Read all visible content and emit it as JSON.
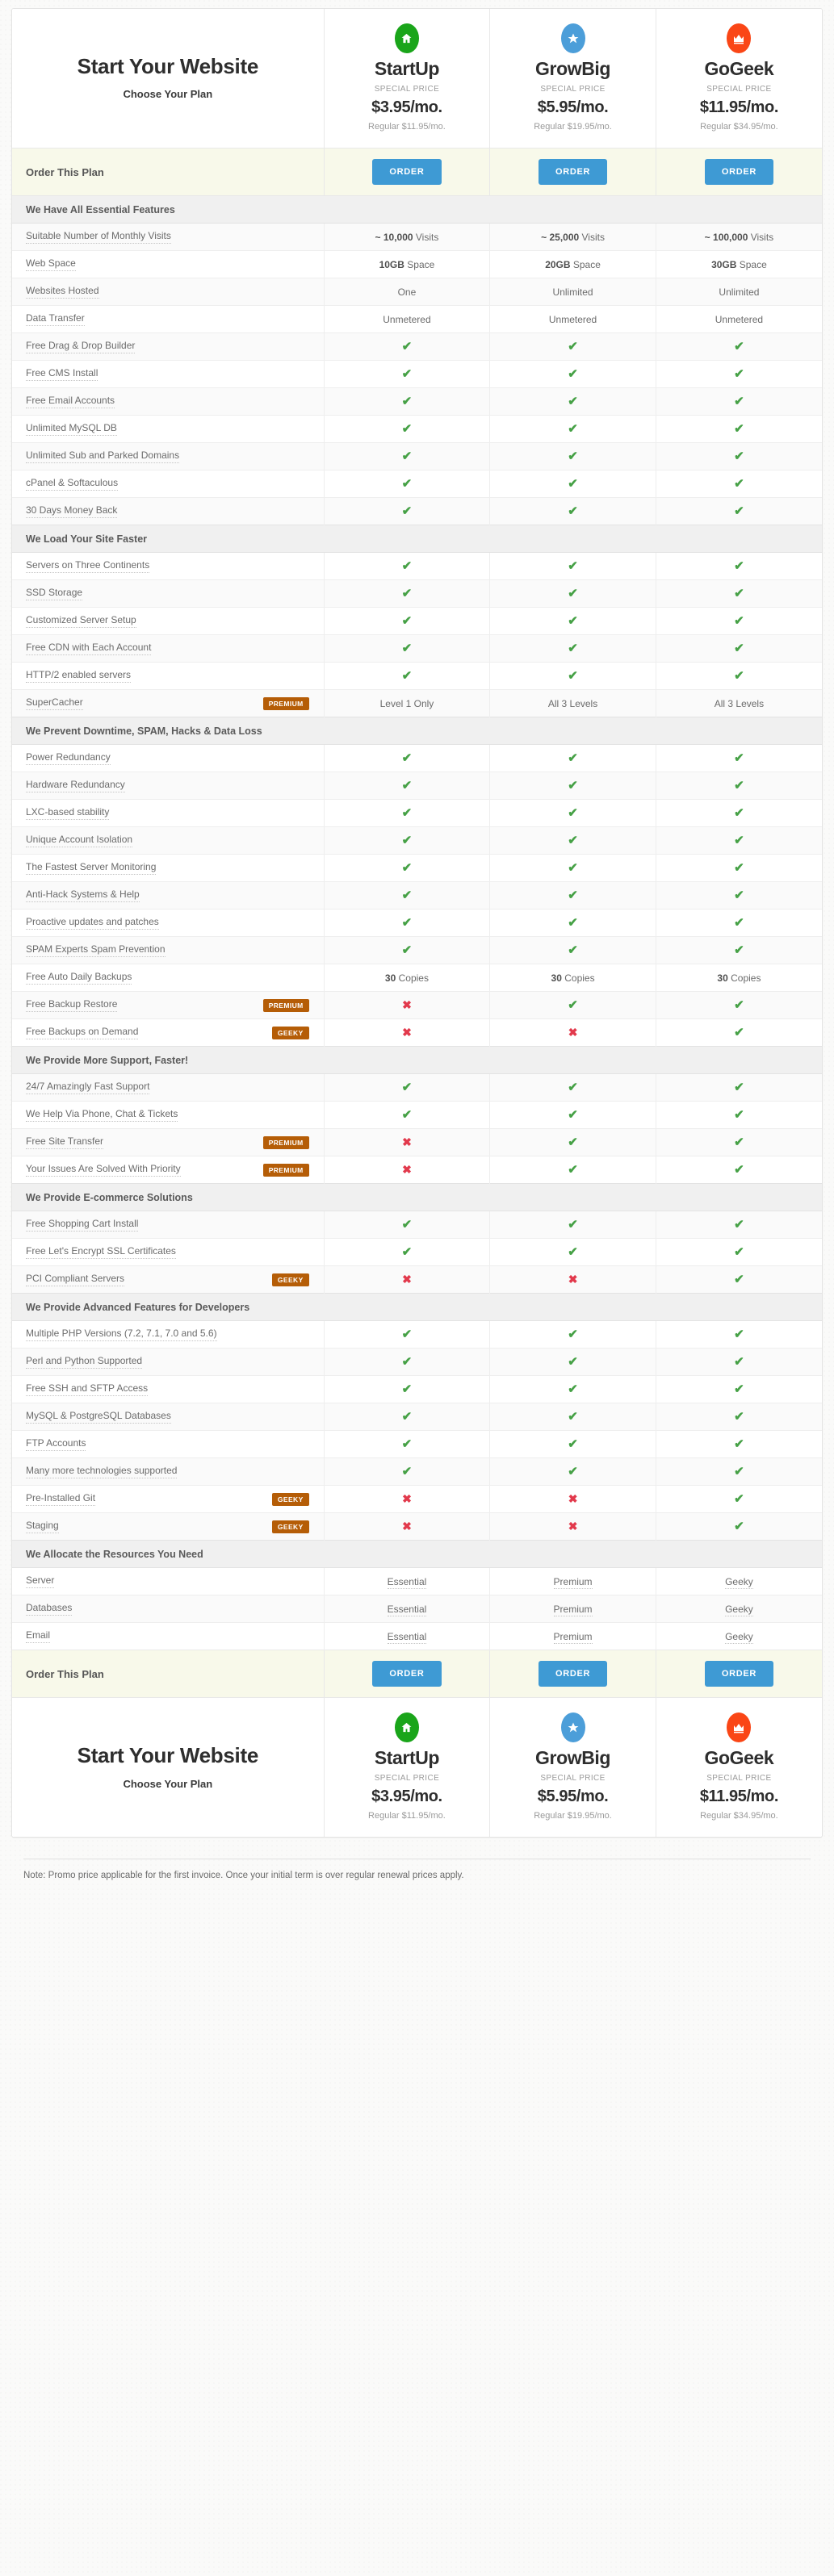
{
  "brand": {
    "title": "Start Your Website",
    "subtitle": "Choose Your Plan"
  },
  "plans": [
    {
      "name": "StartUp",
      "icon": "home-icon",
      "icon_color": "#1aa51a",
      "special_label": "SPECIAL PRICE",
      "price": "$3.95/mo.",
      "regular": "Regular $11.95/mo."
    },
    {
      "name": "GrowBig",
      "icon": "star-icon",
      "icon_color": "#4c9ed9",
      "special_label": "SPECIAL PRICE",
      "price": "$5.95/mo.",
      "regular": "Regular $19.95/mo."
    },
    {
      "name": "GoGeek",
      "icon": "crown-icon",
      "icon_color": "#fa4616",
      "special_label": "SPECIAL PRICE",
      "price": "$11.95/mo.",
      "regular": "Regular $34.95/mo."
    }
  ],
  "order_row": {
    "label": "Order This Plan",
    "button_label": "ORDER"
  },
  "colors": {
    "accent_button": "#3e9ad4",
    "badge": "#b55d07",
    "check": "#46a146",
    "cross": "#e2394c",
    "section_header_bg": "#f0f0f0",
    "order_row_bg": "#f8f9ea"
  },
  "sections": [
    {
      "title": "We Have All Essential Features",
      "rows": [
        {
          "label": "Suitable Number of Monthly Visits",
          "badge": null,
          "values": [
            {
              "type": "text",
              "bold": "~ 10,000",
              "rest": " Visits"
            },
            {
              "type": "text",
              "bold": "~ 25,000",
              "rest": " Visits"
            },
            {
              "type": "text",
              "bold": "~ 100,000",
              "rest": " Visits"
            }
          ]
        },
        {
          "label": "Web Space",
          "badge": null,
          "values": [
            {
              "type": "text",
              "bold": "10GB",
              "rest": " Space"
            },
            {
              "type": "text",
              "bold": "20GB",
              "rest": " Space"
            },
            {
              "type": "text",
              "bold": "30GB",
              "rest": " Space"
            }
          ]
        },
        {
          "label": "Websites Hosted",
          "badge": null,
          "values": [
            {
              "type": "text",
              "bold": "",
              "rest": "One"
            },
            {
              "type": "text",
              "bold": "",
              "rest": "Unlimited"
            },
            {
              "type": "text",
              "bold": "",
              "rest": "Unlimited"
            }
          ]
        },
        {
          "label": "Data Transfer",
          "badge": null,
          "values": [
            {
              "type": "text",
              "bold": "",
              "rest": "Unmetered"
            },
            {
              "type": "text",
              "bold": "",
              "rest": "Unmetered"
            },
            {
              "type": "text",
              "bold": "",
              "rest": "Unmetered"
            }
          ]
        },
        {
          "label": "Free Drag & Drop Builder",
          "badge": null,
          "values": [
            {
              "type": "check"
            },
            {
              "type": "check"
            },
            {
              "type": "check"
            }
          ]
        },
        {
          "label": "Free CMS Install",
          "badge": null,
          "values": [
            {
              "type": "check"
            },
            {
              "type": "check"
            },
            {
              "type": "check"
            }
          ]
        },
        {
          "label": "Free Email Accounts",
          "badge": null,
          "values": [
            {
              "type": "check"
            },
            {
              "type": "check"
            },
            {
              "type": "check"
            }
          ]
        },
        {
          "label": "Unlimited MySQL DB",
          "badge": null,
          "values": [
            {
              "type": "check"
            },
            {
              "type": "check"
            },
            {
              "type": "check"
            }
          ]
        },
        {
          "label": "Unlimited Sub and Parked Domains",
          "badge": null,
          "values": [
            {
              "type": "check"
            },
            {
              "type": "check"
            },
            {
              "type": "check"
            }
          ]
        },
        {
          "label": "cPanel & Softaculous",
          "badge": null,
          "values": [
            {
              "type": "check"
            },
            {
              "type": "check"
            },
            {
              "type": "check"
            }
          ]
        },
        {
          "label": "30 Days Money Back",
          "badge": null,
          "values": [
            {
              "type": "check"
            },
            {
              "type": "check"
            },
            {
              "type": "check"
            }
          ]
        }
      ]
    },
    {
      "title": "We Load Your Site Faster",
      "rows": [
        {
          "label": "Servers on Three Continents",
          "badge": null,
          "values": [
            {
              "type": "check"
            },
            {
              "type": "check"
            },
            {
              "type": "check"
            }
          ]
        },
        {
          "label": "SSD Storage",
          "badge": null,
          "values": [
            {
              "type": "check"
            },
            {
              "type": "check"
            },
            {
              "type": "check"
            }
          ]
        },
        {
          "label": "Customized Server Setup",
          "badge": null,
          "values": [
            {
              "type": "check"
            },
            {
              "type": "check"
            },
            {
              "type": "check"
            }
          ]
        },
        {
          "label": "Free CDN with Each Account",
          "badge": null,
          "values": [
            {
              "type": "check"
            },
            {
              "type": "check"
            },
            {
              "type": "check"
            }
          ]
        },
        {
          "label": "HTTP/2 enabled servers",
          "badge": null,
          "values": [
            {
              "type": "check"
            },
            {
              "type": "check"
            },
            {
              "type": "check"
            }
          ]
        },
        {
          "label": "SuperCacher",
          "badge": "PREMIUM",
          "values": [
            {
              "type": "text",
              "bold": "",
              "rest": "Level 1 Only"
            },
            {
              "type": "text",
              "bold": "",
              "rest": "All 3 Levels"
            },
            {
              "type": "text",
              "bold": "",
              "rest": "All 3 Levels"
            }
          ]
        }
      ]
    },
    {
      "title": "We Prevent Downtime, SPAM, Hacks & Data Loss",
      "rows": [
        {
          "label": "Power Redundancy",
          "badge": null,
          "values": [
            {
              "type": "check"
            },
            {
              "type": "check"
            },
            {
              "type": "check"
            }
          ]
        },
        {
          "label": "Hardware Redundancy",
          "badge": null,
          "values": [
            {
              "type": "check"
            },
            {
              "type": "check"
            },
            {
              "type": "check"
            }
          ]
        },
        {
          "label": "LXC-based stability",
          "badge": null,
          "values": [
            {
              "type": "check"
            },
            {
              "type": "check"
            },
            {
              "type": "check"
            }
          ]
        },
        {
          "label": "Unique Account Isolation",
          "badge": null,
          "values": [
            {
              "type": "check"
            },
            {
              "type": "check"
            },
            {
              "type": "check"
            }
          ]
        },
        {
          "label": "The Fastest Server Monitoring",
          "badge": null,
          "values": [
            {
              "type": "check"
            },
            {
              "type": "check"
            },
            {
              "type": "check"
            }
          ]
        },
        {
          "label": "Anti-Hack Systems & Help",
          "badge": null,
          "values": [
            {
              "type": "check"
            },
            {
              "type": "check"
            },
            {
              "type": "check"
            }
          ]
        },
        {
          "label": "Proactive updates and patches",
          "badge": null,
          "values": [
            {
              "type": "check"
            },
            {
              "type": "check"
            },
            {
              "type": "check"
            }
          ]
        },
        {
          "label": "SPAM Experts Spam Prevention",
          "badge": null,
          "values": [
            {
              "type": "check"
            },
            {
              "type": "check"
            },
            {
              "type": "check"
            }
          ]
        },
        {
          "label": "Free Auto Daily Backups",
          "badge": null,
          "values": [
            {
              "type": "text",
              "bold": "30",
              "rest": " Copies"
            },
            {
              "type": "text",
              "bold": "30",
              "rest": " Copies"
            },
            {
              "type": "text",
              "bold": "30",
              "rest": " Copies"
            }
          ]
        },
        {
          "label": "Free Backup Restore",
          "badge": "PREMIUM",
          "values": [
            {
              "type": "cross"
            },
            {
              "type": "check"
            },
            {
              "type": "check"
            }
          ]
        },
        {
          "label": "Free Backups on Demand",
          "badge": "GEEKY",
          "values": [
            {
              "type": "cross"
            },
            {
              "type": "cross"
            },
            {
              "type": "check"
            }
          ]
        }
      ]
    },
    {
      "title": "We Provide More Support, Faster!",
      "rows": [
        {
          "label": "24/7 Amazingly Fast Support",
          "badge": null,
          "values": [
            {
              "type": "check"
            },
            {
              "type": "check"
            },
            {
              "type": "check"
            }
          ]
        },
        {
          "label": "We Help Via Phone, Chat & Tickets",
          "badge": null,
          "values": [
            {
              "type": "check"
            },
            {
              "type": "check"
            },
            {
              "type": "check"
            }
          ]
        },
        {
          "label": "Free Site Transfer",
          "badge": "PREMIUM",
          "values": [
            {
              "type": "cross"
            },
            {
              "type": "check"
            },
            {
              "type": "check"
            }
          ]
        },
        {
          "label": "Your Issues Are Solved With Priority",
          "badge": "PREMIUM",
          "values": [
            {
              "type": "cross"
            },
            {
              "type": "check"
            },
            {
              "type": "check"
            }
          ]
        }
      ]
    },
    {
      "title": "We Provide E-commerce Solutions",
      "rows": [
        {
          "label": "Free Shopping Cart Install",
          "badge": null,
          "values": [
            {
              "type": "check"
            },
            {
              "type": "check"
            },
            {
              "type": "check"
            }
          ]
        },
        {
          "label": "Free Let's Encrypt SSL Certificates",
          "badge": null,
          "values": [
            {
              "type": "check"
            },
            {
              "type": "check"
            },
            {
              "type": "check"
            }
          ]
        },
        {
          "label": "PCI Compliant Servers",
          "badge": "GEEKY",
          "values": [
            {
              "type": "cross"
            },
            {
              "type": "cross"
            },
            {
              "type": "check"
            }
          ]
        }
      ]
    },
    {
      "title": "We Provide Advanced Features for Developers",
      "rows": [
        {
          "label": "Multiple PHP Versions (7.2, 7.1, 7.0 and 5.6)",
          "badge": null,
          "values": [
            {
              "type": "check"
            },
            {
              "type": "check"
            },
            {
              "type": "check"
            }
          ]
        },
        {
          "label": "Perl and Python Supported",
          "badge": null,
          "values": [
            {
              "type": "check"
            },
            {
              "type": "check"
            },
            {
              "type": "check"
            }
          ]
        },
        {
          "label": "Free SSH and SFTP Access",
          "badge": null,
          "values": [
            {
              "type": "check"
            },
            {
              "type": "check"
            },
            {
              "type": "check"
            }
          ]
        },
        {
          "label": "MySQL & PostgreSQL Databases",
          "badge": null,
          "values": [
            {
              "type": "check"
            },
            {
              "type": "check"
            },
            {
              "type": "check"
            }
          ]
        },
        {
          "label": "FTP Accounts",
          "badge": null,
          "values": [
            {
              "type": "check"
            },
            {
              "type": "check"
            },
            {
              "type": "check"
            }
          ]
        },
        {
          "label": "Many more technologies supported",
          "badge": null,
          "values": [
            {
              "type": "check"
            },
            {
              "type": "check"
            },
            {
              "type": "check"
            }
          ]
        },
        {
          "label": "Pre-Installed Git",
          "badge": "GEEKY",
          "values": [
            {
              "type": "cross"
            },
            {
              "type": "cross"
            },
            {
              "type": "check"
            }
          ]
        },
        {
          "label": "Staging",
          "badge": "GEEKY",
          "values": [
            {
              "type": "cross"
            },
            {
              "type": "cross"
            },
            {
              "type": "check"
            }
          ]
        }
      ]
    },
    {
      "title": "We Allocate the Resources You Need",
      "rows": [
        {
          "label": "Server",
          "badge": null,
          "values": [
            {
              "type": "text",
              "bold": "",
              "rest": "Essential",
              "dotted": true
            },
            {
              "type": "text",
              "bold": "",
              "rest": "Premium",
              "dotted": true
            },
            {
              "type": "text",
              "bold": "",
              "rest": "Geeky",
              "dotted": true
            }
          ]
        },
        {
          "label": "Databases",
          "badge": null,
          "values": [
            {
              "type": "text",
              "bold": "",
              "rest": "Essential",
              "dotted": true
            },
            {
              "type": "text",
              "bold": "",
              "rest": "Premium",
              "dotted": true
            },
            {
              "type": "text",
              "bold": "",
              "rest": "Geeky",
              "dotted": true
            }
          ]
        },
        {
          "label": "Email",
          "badge": null,
          "values": [
            {
              "type": "text",
              "bold": "",
              "rest": "Essential",
              "dotted": true
            },
            {
              "type": "text",
              "bold": "",
              "rest": "Premium",
              "dotted": true
            },
            {
              "type": "text",
              "bold": "",
              "rest": "Geeky",
              "dotted": true
            }
          ]
        }
      ]
    }
  ],
  "footer": {
    "note": "Note: Promo price applicable for the first invoice. Once your initial term is over regular renewal prices apply."
  }
}
